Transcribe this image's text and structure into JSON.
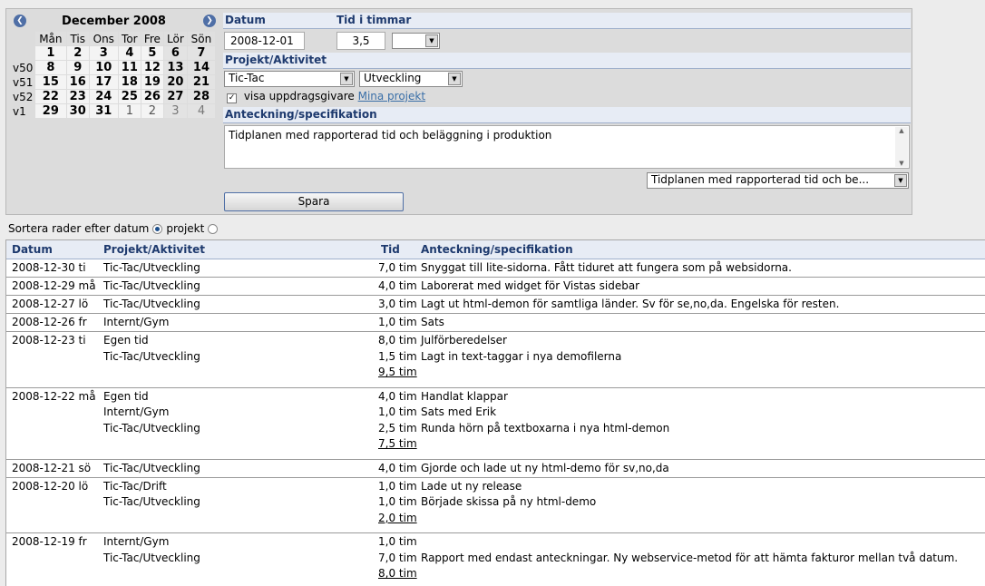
{
  "calendar": {
    "title": "December 2008",
    "weekdays": [
      "Mån",
      "Tis",
      "Ons",
      "Tor",
      "Fre",
      "Lör",
      "Sön"
    ],
    "weeks": [
      {
        "wk": "",
        "days": [
          "",
          "1",
          "2",
          "3",
          "4",
          "5",
          "6",
          "7"
        ]
      },
      {
        "wk": "v50",
        "days": [
          "",
          "8",
          "9",
          "10",
          "11",
          "12",
          "13",
          "14"
        ]
      },
      {
        "wk": "v51",
        "days": [
          "",
          "15",
          "16",
          "17",
          "18",
          "19",
          "20",
          "21"
        ]
      },
      {
        "wk": "v52",
        "days": [
          "",
          "22",
          "23",
          "24",
          "25",
          "26",
          "27",
          "28"
        ]
      },
      {
        "wk": "v1",
        "days": [
          "",
          "29",
          "30",
          "31",
          "1",
          "2",
          "3",
          "4"
        ]
      }
    ]
  },
  "form": {
    "date_label": "Datum",
    "date_value": "2008-12-01",
    "hours_label": "Tid i timmar",
    "hours_value": "3,5",
    "hours_select": "",
    "project_label": "Projekt/Aktivitet",
    "project_value": "Tic-Tac",
    "activity_value": "Utveckling",
    "show_clients_label": "visa uppdragsgivare",
    "my_projects_link": "Mina projekt",
    "note_label": "Anteckning/specifikation",
    "note_value": "Tidplanen med rapporterad tid och beläggning i produktion",
    "note_history_value": "Tidplanen med rapporterad tid och be...",
    "save_label": "Spara"
  },
  "sort": {
    "label": "Sortera rader efter datum",
    "option_project": "projekt"
  },
  "list": {
    "headers": {
      "date": "Datum",
      "project": "Projekt/Aktivitet",
      "time": "Tid",
      "note": "Anteckning/specifikation"
    },
    "groups": [
      {
        "date": "2008-12-30 ti",
        "rows": [
          {
            "project": "Tic-Tac/Utveckling",
            "time": "7,0 tim",
            "note": "Snyggat till lite-sidorna. Fått tiduret att fungera som på websidorna."
          }
        ],
        "sum": ""
      },
      {
        "date": "2008-12-29 må",
        "rows": [
          {
            "project": "Tic-Tac/Utveckling",
            "time": "4,0 tim",
            "note": "Laborerat med widget för Vistas sidebar"
          }
        ],
        "sum": ""
      },
      {
        "date": "2008-12-27 lö",
        "rows": [
          {
            "project": "Tic-Tac/Utveckling",
            "time": "3,0 tim",
            "note": "Lagt ut html-demon för samtliga länder. Sv för se,no,da. Engelska för resten."
          }
        ],
        "sum": ""
      },
      {
        "date": "2008-12-26 fr",
        "rows": [
          {
            "project": "Internt/Gym",
            "time": "1,0 tim",
            "note": "Sats"
          }
        ],
        "sum": ""
      },
      {
        "date": "2008-12-23 ti",
        "rows": [
          {
            "project": "Egen tid",
            "time": "8,0 tim",
            "note": "Julförberedelser"
          },
          {
            "project": "Tic-Tac/Utveckling",
            "time": "1,5 tim",
            "note": "Lagt in text-taggar i nya demofilerna"
          }
        ],
        "sum": "9,5 tim"
      },
      {
        "date": "2008-12-22 må",
        "rows": [
          {
            "project": "Egen tid",
            "time": "4,0 tim",
            "note": "Handlat klappar"
          },
          {
            "project": "Internt/Gym",
            "time": "1,0 tim",
            "note": "Sats med Erik"
          },
          {
            "project": "Tic-Tac/Utveckling",
            "time": "2,5 tim",
            "note": "Runda hörn på textboxarna i nya html-demon"
          }
        ],
        "sum": "7,5 tim"
      },
      {
        "date": "2008-12-21 sö",
        "rows": [
          {
            "project": "Tic-Tac/Utveckling",
            "time": "4,0 tim",
            "note": "Gjorde och lade ut ny html-demo för sv,no,da"
          }
        ],
        "sum": ""
      },
      {
        "date": "2008-12-20 lö",
        "rows": [
          {
            "project": "Tic-Tac/Drift",
            "time": "1,0 tim",
            "note": "Lade ut ny release"
          },
          {
            "project": "Tic-Tac/Utveckling",
            "time": "1,0 tim",
            "note": "Började skissa på ny html-demo"
          }
        ],
        "sum": "2,0 tim"
      },
      {
        "date": "2008-12-19 fr",
        "rows": [
          {
            "project": "Internt/Gym",
            "time": "1,0 tim",
            "note": ""
          },
          {
            "project": "Tic-Tac/Utveckling",
            "time": "7,0 tim",
            "note": "Rapport med endast anteckningar. Ny webservice-metod för att hämta fakturor mellan två datum."
          }
        ],
        "sum": "8,0 tim"
      }
    ]
  }
}
